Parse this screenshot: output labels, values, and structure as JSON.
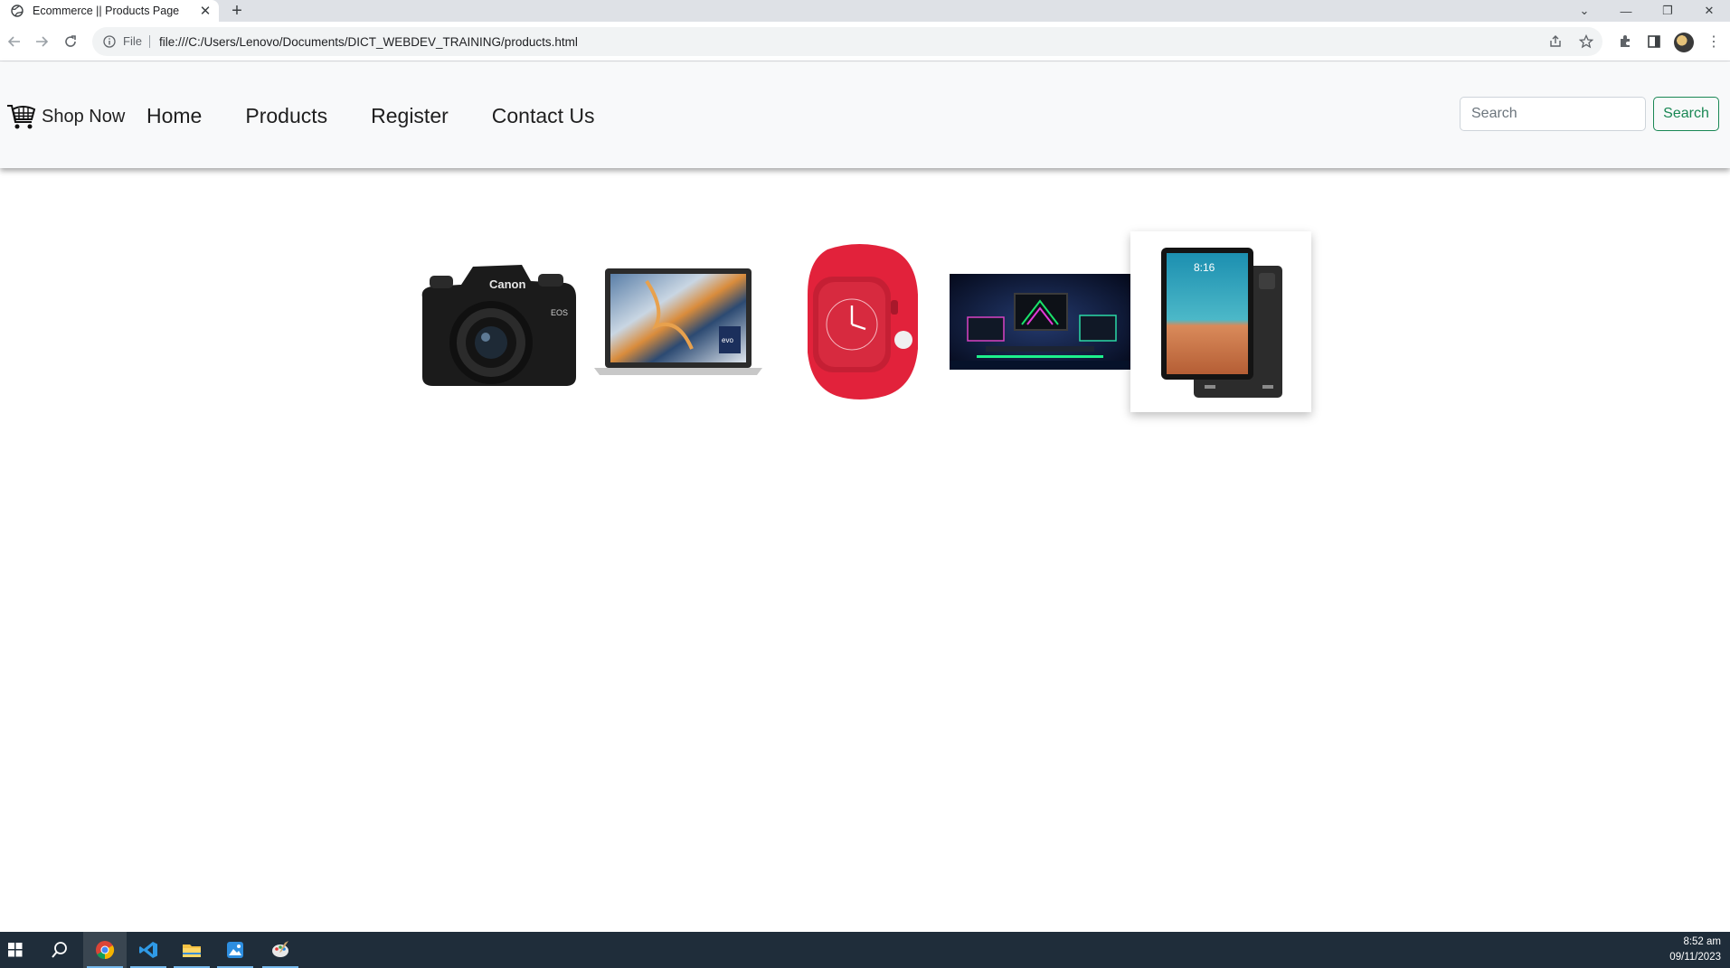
{
  "browser": {
    "tab_title": "Ecommerce || Products Page",
    "address_scheme_label": "File",
    "url": "file:///C:/Users/Lenovo/Documents/DICT_WEBDEV_TRAINING/products.html"
  },
  "navbar": {
    "brand": "Shop Now",
    "links": [
      "Home",
      "Products",
      "Register",
      "Contact Us"
    ],
    "search_placeholder": "Search",
    "search_button": "Search"
  },
  "products": [
    {
      "name": "camera",
      "icon": "camera-image"
    },
    {
      "name": "laptop",
      "icon": "laptop-image"
    },
    {
      "name": "smartwatch",
      "icon": "watch-image"
    },
    {
      "name": "gaming-setup",
      "icon": "gaming-setup-image"
    },
    {
      "name": "tablet",
      "icon": "tablet-image",
      "highlighted": true
    }
  ],
  "taskbar": {
    "time": "8:52 am",
    "date": "09/11/2023"
  },
  "colors": {
    "accent_success": "#198754",
    "navbar_bg": "#f8f9fa",
    "taskbar_bg": "#1f2d3a"
  }
}
